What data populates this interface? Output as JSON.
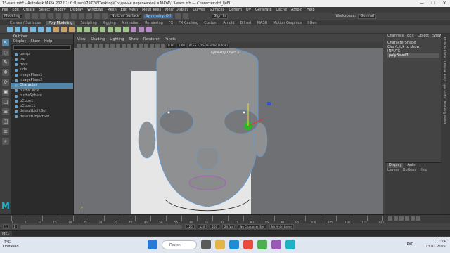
{
  "window": {
    "title": "13-ears.mb* - Autodesk MAYA 2022.2: C:\\Users\\79776\\Desktop\\Создание персонажей в MAYA\\13-ears.mb  ---  Character:ctrl_ljeEL..."
  },
  "menubar": [
    "File",
    "Edit",
    "Create",
    "Select",
    "Modify",
    "Display",
    "Windows",
    "Mesh",
    "Edit Mesh",
    "Mesh Tools",
    "Mesh Display",
    "Curves",
    "Surfaces",
    "Deform",
    "UV",
    "Generate",
    "Cache",
    "Arnold",
    "Help"
  ],
  "statusline": {
    "mode": "Modeling",
    "live": "No Live Surface",
    "symmetry": "Symmetry: Off",
    "signin": "Sign In",
    "workspace_label": "Workspace:",
    "workspace": "General"
  },
  "shelf_tabs": [
    "Curves / Surfaces",
    "Poly Modeling",
    "Sculpting",
    "Rigging",
    "Animation",
    "Rendering",
    "FX",
    "FX Caching",
    "Custom",
    "Arnold",
    "Bifrost",
    "MASH",
    "Motion Graphics",
    "XGen"
  ],
  "outliner": {
    "title": "Outliner",
    "menu": [
      "Display",
      "Show",
      "Help"
    ],
    "items": [
      "persp",
      "top",
      "front",
      "side",
      "imagePlane1",
      "imagePlane2",
      "Character",
      "nurbsCircle",
      "nurbsSphere",
      "pCube1",
      "pCube11",
      "defaultLightSet",
      "defaultObjectSet"
    ],
    "selected_index": 6
  },
  "viewport": {
    "menu": [
      "View",
      "Shading",
      "Lighting",
      "Show",
      "Renderer",
      "Panels"
    ],
    "near": "0.00",
    "far": "1.00",
    "colorspace": "ACES 1.0 SDR-video (sRGB)",
    "camera_label": "Symmetry: Object X"
  },
  "channels": {
    "menu": [
      "Channels",
      "Edit",
      "Object",
      "Show"
    ],
    "object": "CharacterShape",
    "lines": [
      "CVs (click to show)",
      "INPUTS",
      "polyBevel3"
    ],
    "display": {
      "tabs": [
        "Display",
        "Anim"
      ],
      "menu": [
        "Layers",
        "Options",
        "Help"
      ]
    },
    "side_tabs": [
      "Attribute Editor",
      "Channel Box / Layer Editor",
      "Modeling Toolkit"
    ]
  },
  "timeline": {
    "ticks": [
      "1",
      "5",
      "10",
      "15",
      "20",
      "25",
      "30",
      "35",
      "40",
      "45",
      "50",
      "55",
      "60",
      "65",
      "70",
      "75",
      "80",
      "85",
      "90",
      "95",
      "100",
      "105",
      "110",
      "115",
      "120"
    ]
  },
  "range": {
    "start": "1",
    "start2": "1",
    "end": "120",
    "end2": "120",
    "end3": "200",
    "fps": "24 fps",
    "char": "No Character Set",
    "anim": "No Anim Layer"
  },
  "cmd": {
    "label": "MEL"
  },
  "taskbar": {
    "weather_temp": "-7°C",
    "weather_text": "Облачно",
    "search": "Поиск",
    "lang": "РУС",
    "time": "17:24",
    "date": "13.01.2022"
  }
}
